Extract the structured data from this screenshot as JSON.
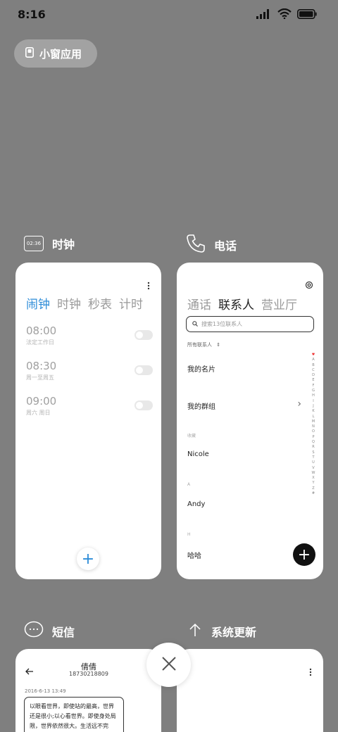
{
  "status_bar": {
    "time": "8:16"
  },
  "small_window": {
    "label": "小窗应用"
  },
  "cards": {
    "clock": {
      "icon_text": "02:36",
      "title": "时钟",
      "tabs": [
        "闹钟",
        "时钟",
        "秒表",
        "计时"
      ],
      "alarms": [
        {
          "time": "08:00",
          "sub": "法定工作日"
        },
        {
          "time": "08:30",
          "sub": "周一至周五"
        },
        {
          "time": "09:00",
          "sub": "周六 周日"
        }
      ],
      "add_label": "+"
    },
    "phone": {
      "title": "电话",
      "tabs": [
        "通话",
        "联系人",
        "营业厅"
      ],
      "search_placeholder": "搜索13位联系人",
      "filter_label": "所有联系人",
      "my_card": "我的名片",
      "my_groups": "我的群组",
      "sections": [
        {
          "label": "收藏",
          "name": "Nicole"
        },
        {
          "label": "A",
          "name": "Andy"
        },
        {
          "label": "H",
          "name": "哈哈"
        }
      ],
      "alpha_index": [
        "♥",
        "A",
        "B",
        "C",
        "D",
        "E",
        "F",
        "G",
        "H",
        "I",
        "J",
        "K",
        "L",
        "M",
        "N",
        "O",
        "P",
        "Q",
        "R",
        "S",
        "T",
        "U",
        "V",
        "W",
        "X",
        "Y",
        "Z",
        "#"
      ],
      "add_label": "+"
    },
    "sms": {
      "title": "短信",
      "contact_name": "倩倩",
      "contact_number": "18730218809",
      "date": "2016-6-13 13:49",
      "message": "以眼看世界，即使站的最高，世界还是很小;以心看世界。即使身处局限，世界依然很大。生活远不完"
    },
    "update": {
      "title": "系统更新"
    }
  }
}
